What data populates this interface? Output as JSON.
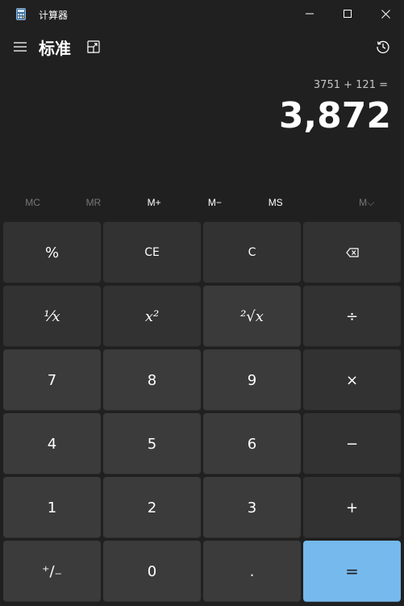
{
  "window": {
    "title": "计算器",
    "icon": "calculator-icon"
  },
  "header": {
    "mode_title": "标准",
    "menu_icon": "hamburger-icon",
    "keep_on_top_icon": "keep-on-top-icon",
    "history_icon": "history-icon"
  },
  "display": {
    "expression": "3751 + 121 =",
    "result": "3,872"
  },
  "memory": {
    "mc": "MC",
    "mr": "MR",
    "mplus": "M+",
    "mminus": "M−",
    "ms": "MS",
    "mlist": "M⌵"
  },
  "keys": {
    "percent": "%",
    "ce": "CE",
    "c": "C",
    "backspace_icon": "backspace-icon",
    "reciprocal": "¹⁄x",
    "square": "x²",
    "sqrt": "²√x",
    "divide": "÷",
    "seven": "7",
    "eight": "8",
    "nine": "9",
    "multiply": "×",
    "four": "4",
    "five": "5",
    "six": "6",
    "minus": "−",
    "one": "1",
    "two": "2",
    "three": "3",
    "plus": "+",
    "negate": "⁺∕₋",
    "zero": "0",
    "decimal": ".",
    "equals": "="
  },
  "colors": {
    "background": "#202020",
    "key_number": "#3b3b3b",
    "key_operator": "#323232",
    "equals_accent": "#76b9ed",
    "disabled_text": "#777777"
  }
}
